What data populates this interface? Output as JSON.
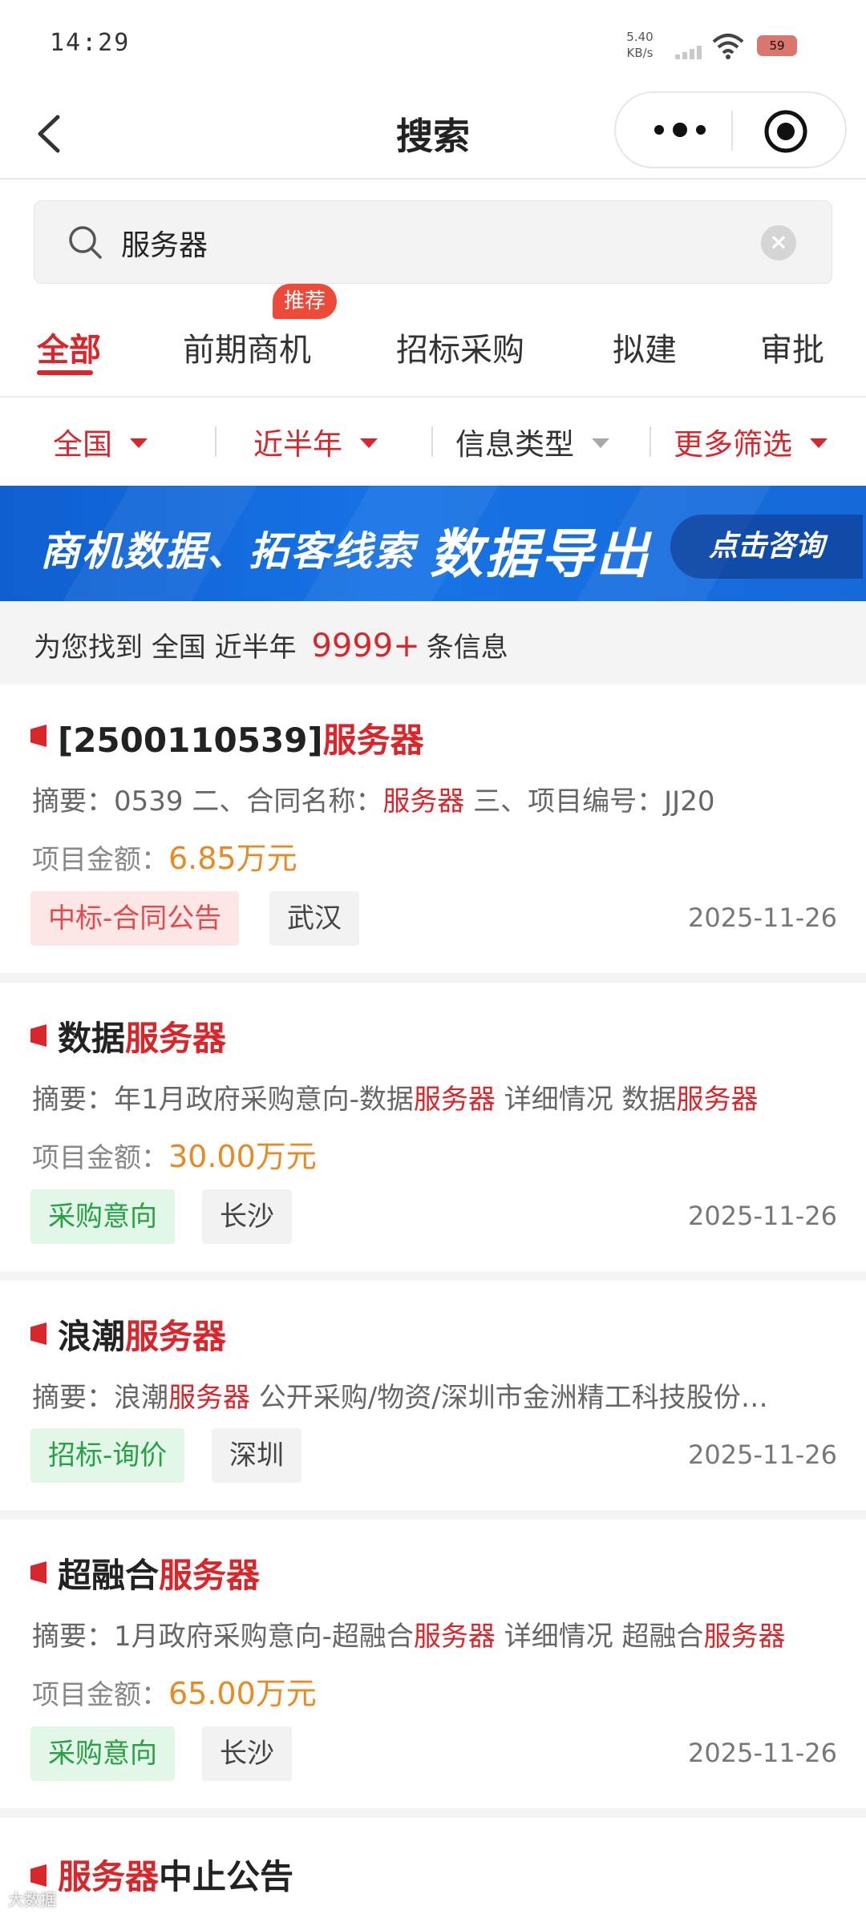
{
  "status_bar": {
    "time": "14:29",
    "net_speed_value": "5.40",
    "net_speed_unit": "KB/s",
    "battery": "59"
  },
  "nav": {
    "title": "搜索"
  },
  "search": {
    "query": "服务器"
  },
  "tabs": [
    {
      "label": "全部",
      "active": true
    },
    {
      "label": "前期商机",
      "badge": "推荐"
    },
    {
      "label": "招标采购"
    },
    {
      "label": "拟建"
    },
    {
      "label": "审批"
    }
  ],
  "filters": [
    {
      "label": "全国"
    },
    {
      "label": "近半年"
    },
    {
      "label": "信息类型"
    },
    {
      "label": "更多筛选"
    }
  ],
  "banner": {
    "text_left": "商机数据、拓客线索",
    "text_main": "数据导出",
    "button": "点击咨询"
  },
  "summary": {
    "prefix": "为您找到",
    "region": "全国",
    "period": "近半年",
    "count": "9999+",
    "suffix": "条信息"
  },
  "results": [
    {
      "title_pre": "[2500110539]",
      "title_hl": "服务器",
      "title_post": "",
      "abstract_a": "摘要：0539 二、合同名称：",
      "abstract_hl1": "服务器",
      "abstract_b": " 三、项目编号：JJ20",
      "abstract_hl2": "",
      "abstract_c": "",
      "amount_label": "项目金额：",
      "amount": "6.85万元",
      "tag_type": "中标-合同公告",
      "tag_city": "武汉",
      "date": "2025-11-26"
    },
    {
      "title_pre": "数据",
      "title_hl": "服务器",
      "title_post": "",
      "abstract_a": "摘要：年1月政府采购意向-数据",
      "abstract_hl1": "服务器",
      "abstract_b": " 详细情况 数据",
      "abstract_hl2": "服务器",
      "abstract_c": "",
      "amount_label": "项目金额：",
      "amount": "30.00万元",
      "tag_type": "采购意向",
      "tag_city": "长沙",
      "date": "2025-11-26"
    },
    {
      "title_pre": "浪潮",
      "title_hl": "服务器",
      "title_post": "",
      "abstract_a": "摘要：浪潮",
      "abstract_hl1": "服务器",
      "abstract_b": " 公开采购/物资/深圳市金洲精工科技股份…",
      "abstract_hl2": "",
      "abstract_c": "",
      "tag_type": "招标-询价",
      "tag_city": "深圳",
      "date": "2025-11-26"
    },
    {
      "title_pre": "超融合",
      "title_hl": "服务器",
      "title_post": "",
      "abstract_a": "摘要：1月政府采购意向-超融合",
      "abstract_hl1": "服务器",
      "abstract_b": " 详细情况 超融合",
      "abstract_hl2": "服务器",
      "abstract_c": "",
      "amount_label": "项目金额：",
      "amount": "65.00万元",
      "tag_type": "采购意向",
      "tag_city": "长沙",
      "date": "2025-11-26"
    },
    {
      "title_pre": "",
      "title_hl": "服务器",
      "title_post": "中止公告"
    }
  ],
  "watermark": "大数据"
}
